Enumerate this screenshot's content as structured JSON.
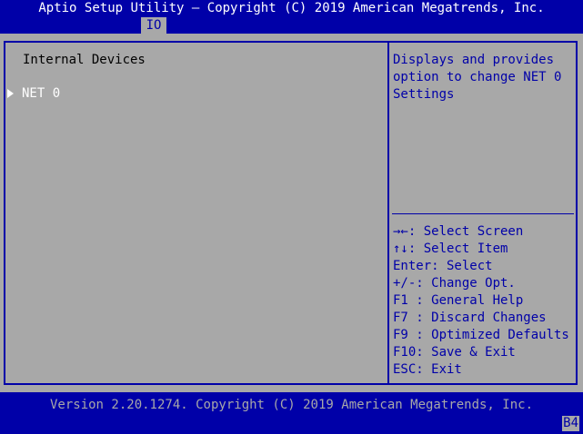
{
  "header": {
    "title": "Aptio Setup Utility – Copyright (C) 2019 American Megatrends, Inc.",
    "active_tab": "IO"
  },
  "main": {
    "heading": "Internal Devices",
    "items": [
      {
        "label": "NET 0",
        "type": "submenu",
        "selected": true
      }
    ]
  },
  "help": {
    "description": "Displays and provides option to change NET 0 Settings"
  },
  "keys": [
    {
      "label": "→←: Select Screen"
    },
    {
      "label": "↑↓: Select Item"
    },
    {
      "label": "Enter: Select"
    },
    {
      "label": "+/-: Change Opt."
    },
    {
      "label": "F1 : General Help"
    },
    {
      "label": "F7 : Discard Changes"
    },
    {
      "label": "F9 : Optimized Defaults"
    },
    {
      "label": "F10: Save & Exit"
    },
    {
      "label": "ESC: Exit"
    }
  ],
  "footer": {
    "version": "Version 2.20.1274. Copyright (C) 2019 American Megatrends, Inc.",
    "post_code": "B4"
  },
  "colors": {
    "background_blue": "#0000a8",
    "panel_gray": "#a8a8a8",
    "highlight_white": "#ffffff"
  }
}
